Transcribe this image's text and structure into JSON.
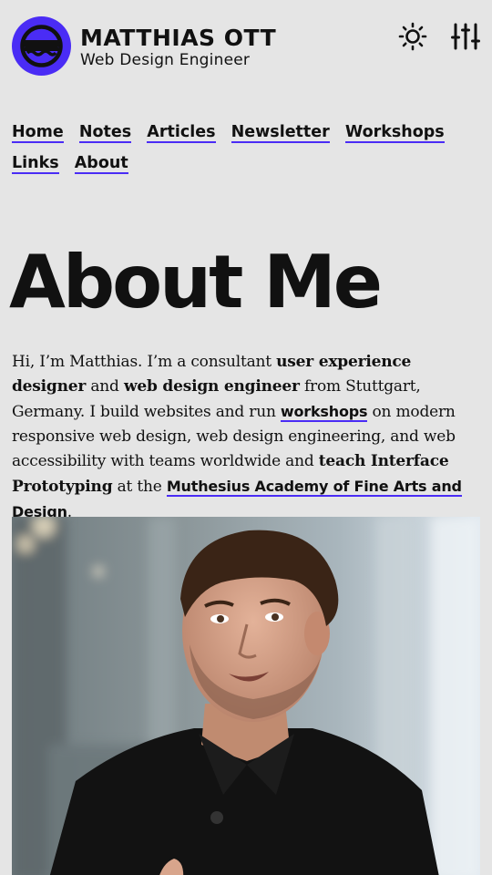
{
  "header": {
    "site_name": "MATTHIAS OTT",
    "tagline": "Web Design Engineer",
    "logo_icon": "avatar-logo-icon",
    "theme_toggle_icon": "sun-icon",
    "settings_icon": "sliders-icon",
    "brand_color": "#4a2cf5"
  },
  "nav": {
    "items": [
      {
        "label": "Home"
      },
      {
        "label": "Notes"
      },
      {
        "label": "Articles"
      },
      {
        "label": "Newsletter"
      },
      {
        "label": "Workshops"
      },
      {
        "label": "Links"
      },
      {
        "label": "About"
      }
    ]
  },
  "page": {
    "title": "About Me"
  },
  "intro": {
    "t1": "Hi, I’m Matthias. I’m a consultant ",
    "b1": "user experience designer",
    "t2": " and ",
    "b2": "web design engineer",
    "t3": " from Stuttgart, Germany. I build websites and run ",
    "link1": "workshops",
    "t4": " on modern responsive web design, web design engineering, and web accessibility with teams worldwide and ",
    "b3": "teach Interface Prototyping",
    "t5": " at the ",
    "link2": "Muthesius Academy of Fine Arts and Design",
    "t6": "."
  },
  "colors": {
    "background": "#e5e5e5",
    "text": "#111111",
    "accent": "#4a2cf5"
  }
}
